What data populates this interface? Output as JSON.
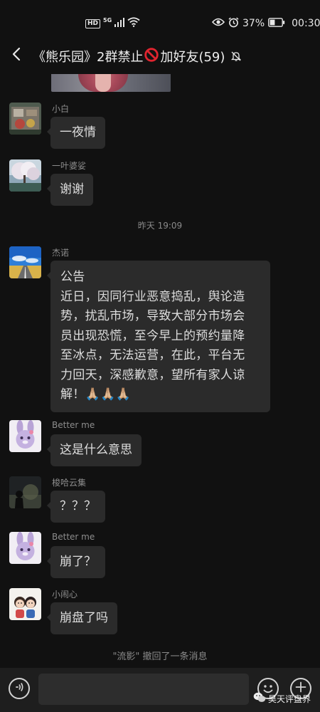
{
  "status_bar": {
    "hd_label": "HD",
    "network_label": "5G",
    "battery": "37%",
    "time": "00:30"
  },
  "header": {
    "title_part1": "《熊乐园》2群禁止",
    "title_part2": "加好友(59)"
  },
  "messages": [
    {
      "sender": "小白",
      "text": "一夜情"
    },
    {
      "sender": "一叶婆娑",
      "text": "谢谢"
    },
    {
      "sender": "杰诺",
      "lines": [
        "公告",
        "近日，因同行业恶意捣乱，舆论造",
        "势，扰乱市场，导致大部分市场会",
        "员出现恐慌，至今早上的预约量降",
        "至冰点，无法运营，在此，平台无",
        "力回天，深感歉意，望所有家人谅",
        "解！🙏🏼🙏🏼🙏🏼"
      ]
    },
    {
      "sender": "Better  me",
      "text": "这是什么意思"
    },
    {
      "sender": "梭哈云集",
      "text": "？？？"
    },
    {
      "sender": "Better  me",
      "text": "崩了？"
    },
    {
      "sender": "小闹心",
      "text": "崩盘了吗"
    }
  ],
  "time_separator": "昨天 19:09",
  "recall_notice": "\"流影\" 撤回了一条消息",
  "input": {
    "value": ""
  },
  "watermark": "昊天评盘界",
  "colors": {
    "background": "#111111",
    "bubble": "#2b2b2b",
    "sender_text": "#8d8d8d",
    "no_sign": "#e0242f"
  },
  "icons": {
    "back": "chevron-left-icon",
    "mute": "bell-off-icon",
    "no_entry": "prohibited-sign-icon",
    "voice": "voice-icon",
    "emoji": "emoji-icon",
    "plus": "plus-icon"
  }
}
